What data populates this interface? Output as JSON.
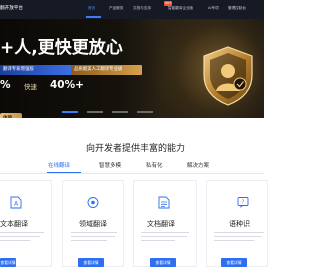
{
  "header": {
    "brand": "翻开放平台",
    "hot_badge": "HOT",
    "nav": [
      {
        "label": "首页",
        "active": true
      },
      {
        "label": "产品服务"
      },
      {
        "label": "文档与支持"
      },
      {
        "label": "智能翻译企业版"
      },
      {
        "label": "AI专项"
      },
      {
        "label": "管理控制台"
      }
    ]
  },
  "banner": {
    "headline": "+人,更快更放心",
    "badge_blue": "翻译专家增强版",
    "badge_gold": "品质媲美人工翻译专业级",
    "promo_left": "%",
    "promo_mid": "快速",
    "promo_right": "40%+",
    "cta": "体验",
    "dots": 4,
    "active_dot": 0,
    "colors": {
      "gold": "#d7a24b",
      "blue": "#3c6fe8",
      "dark": "#0b0906"
    }
  },
  "capabilities": {
    "title": "向开发者提供丰富的能力",
    "tabs": [
      {
        "label": "在线翻译",
        "active": true
      },
      {
        "label": "智慧多模"
      },
      {
        "label": "私有化"
      },
      {
        "label": "解决方案"
      }
    ],
    "cards": [
      {
        "title": "文本翻译",
        "icon": "document-a-icon",
        "button": "查看详情"
      },
      {
        "title": "领域翻译",
        "icon": "domain-target-icon",
        "button": "查看详情"
      },
      {
        "title": "文档翻译",
        "icon": "file-icon",
        "button": "查看详情"
      },
      {
        "title": "语种识",
        "icon": "language-id-icon",
        "button": "查看详情"
      }
    ]
  }
}
